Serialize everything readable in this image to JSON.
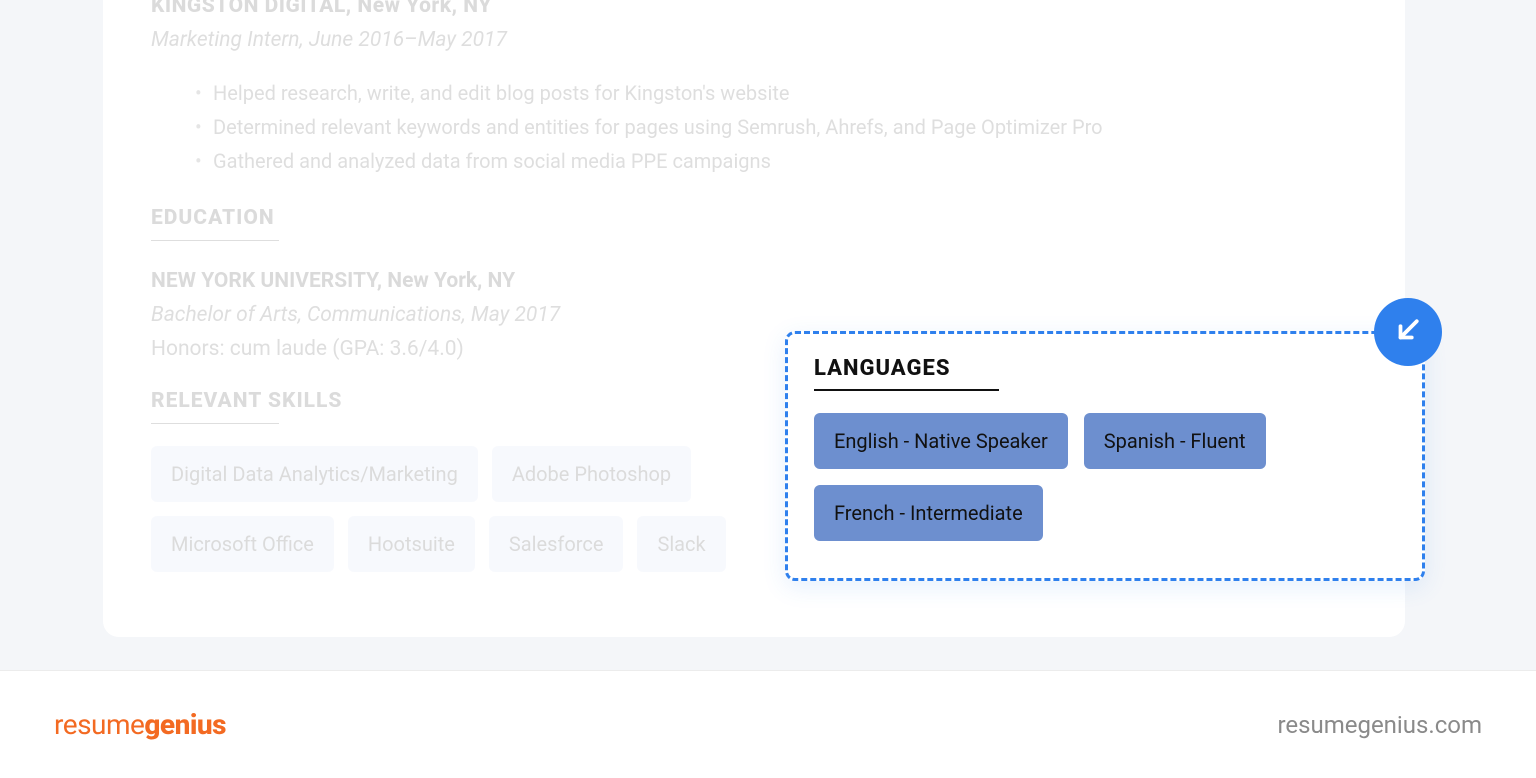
{
  "experience": {
    "company": "KINGSTON DIGITAL, New York, NY",
    "role": "Marketing Intern, June 2016–May 2017",
    "bullets": [
      "Helped research, write, and edit blog posts for Kingston's website",
      "Determined relevant keywords and entities for pages using Semrush, Ahrefs, and Page Optimizer Pro",
      "Gathered and analyzed data from social media PPE campaigns"
    ]
  },
  "education": {
    "heading": "EDUCATION",
    "school": "NEW YORK UNIVERSITY, New York, NY",
    "degree": "Bachelor of Arts, Communications, May 2017",
    "honors": "Honors: cum laude (GPA: 3.6/4.0)"
  },
  "skills": {
    "heading": "RELEVANT SKILLS",
    "items": [
      "Digital Data Analytics/Marketing",
      "Adobe Photoshop",
      "Microsoft Office",
      "Hootsuite",
      "Salesforce",
      "Slack"
    ]
  },
  "languages": {
    "heading": "LANGUAGES",
    "items": [
      "English - Native Speaker",
      "Spanish - Fluent",
      "French - Intermediate"
    ]
  },
  "footer": {
    "brand_light": "resume",
    "brand_bold": "genius",
    "url": "resumegenius.com"
  }
}
